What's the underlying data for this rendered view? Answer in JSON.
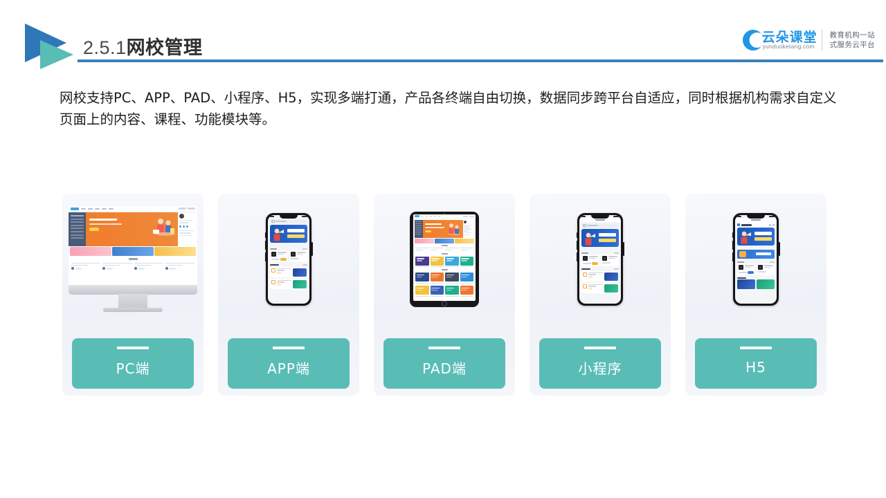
{
  "header": {
    "section_number": "2.5.1",
    "title": "网校管理",
    "logo_mark_name": "double-triangle-logo",
    "rule_color": "#3d7fb5"
  },
  "brand": {
    "name_cn": "云朵课堂",
    "url": "yunduoketang.com",
    "tagline": "教育机构一站\n式服务云平台",
    "color": "#2196e8"
  },
  "body": {
    "paragraph": "网校支持PC、APP、PAD、小程序、H5，实现多端打通，产品各终端自由切换，数据同步跨平台自适应，同时根据机构需求自定义页面上的内容、课程、功能模块等。"
  },
  "colors": {
    "accent_teal": "#59bdb6",
    "accent_blue": "#3d7fb5",
    "card_bg": "#f2f4f8",
    "hero_orange": "#f07d2c",
    "banner_blue": "#2f6fd8"
  },
  "cards": [
    {
      "label": "PC端",
      "device": "desktop-monitor",
      "device_name": "imac-mockup"
    },
    {
      "label": "APP端",
      "device": "smartphone",
      "device_name": "phone-app-mockup"
    },
    {
      "label": "PAD端",
      "device": "tablet",
      "device_name": "ipad-mockup"
    },
    {
      "label": "小程序",
      "device": "smartphone",
      "device_name": "phone-miniprogram-mockup"
    },
    {
      "label": "H5",
      "device": "smartphone",
      "device_name": "phone-h5-mockup"
    }
  ]
}
